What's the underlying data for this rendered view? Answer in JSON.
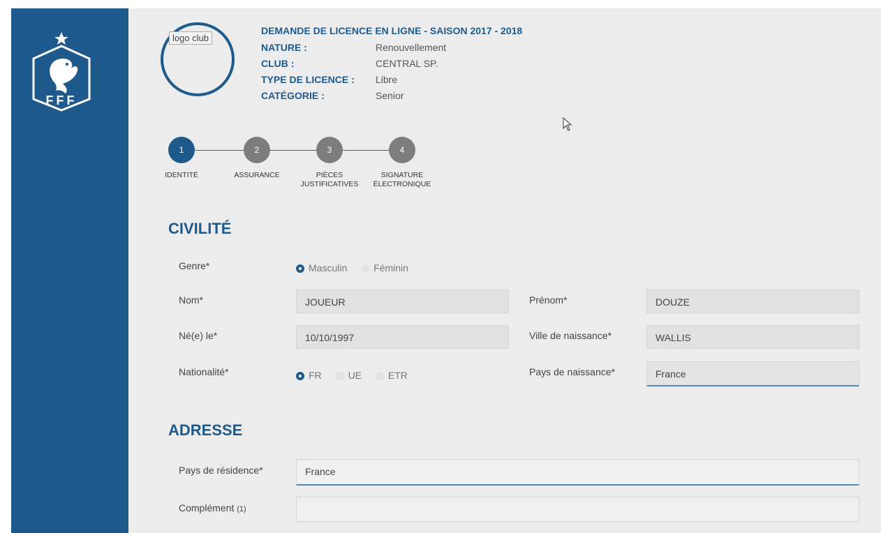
{
  "sidebar": {
    "logo_text": "FFF"
  },
  "club": {
    "logo_label": "logo club"
  },
  "header": {
    "title": "DEMANDE DE LICENCE EN LIGNE - SAISON 2017 - 2018",
    "rows": [
      {
        "key": "NATURE :",
        "value": "Renouvellement"
      },
      {
        "key": "CLUB :",
        "value": "CENTRAL SP."
      },
      {
        "key": "TYPE DE LICENCE :",
        "value": "Libre"
      },
      {
        "key": "CATÉGORIE :",
        "value": "Senior"
      }
    ]
  },
  "steps": [
    {
      "number": "1",
      "label_line1": "IDENTITÉ",
      "label_line2": "",
      "active": true
    },
    {
      "number": "2",
      "label_line1": "ASSURANCE",
      "label_line2": "",
      "active": false
    },
    {
      "number": "3",
      "label_line1": "PIÈCES",
      "label_line2": "JUSTIFICATIVES",
      "active": false
    },
    {
      "number": "4",
      "label_line1": "SIGNATURE",
      "label_line2": "ÉLECTRONIQUE",
      "active": false
    }
  ],
  "civilite": {
    "title": "CIVILITÉ",
    "genre": {
      "label": "Genre*",
      "options": [
        "Masculin",
        "Féminin"
      ],
      "selected": "Masculin"
    },
    "nom": {
      "label": "Nom*",
      "value": "JOUEUR"
    },
    "prenom": {
      "label": "Prénom*",
      "value": "DOUZE"
    },
    "ne_le": {
      "label": "Né(e) le*",
      "value": "10/10/1997"
    },
    "ville_naissance": {
      "label": "Ville de naissance*",
      "value": "WALLIS"
    },
    "nationalite": {
      "label": "Nationalité*",
      "options": [
        "FR",
        "UE",
        "ETR"
      ],
      "selected": "FR"
    },
    "pays_naissance": {
      "label": "Pays de naissance*",
      "value": "France"
    }
  },
  "adresse": {
    "title": "ADRESSE",
    "pays_residence": {
      "label": "Pays de résidence*",
      "value": "France"
    },
    "complement": {
      "label": "Complément",
      "note": "(1)",
      "value": ""
    }
  },
  "colors": {
    "primary": "#1e5a8c",
    "step_inactive": "#7d7d7d",
    "field_bg": "#e1e1e1",
    "focus_underline": "#4a8bb8"
  }
}
